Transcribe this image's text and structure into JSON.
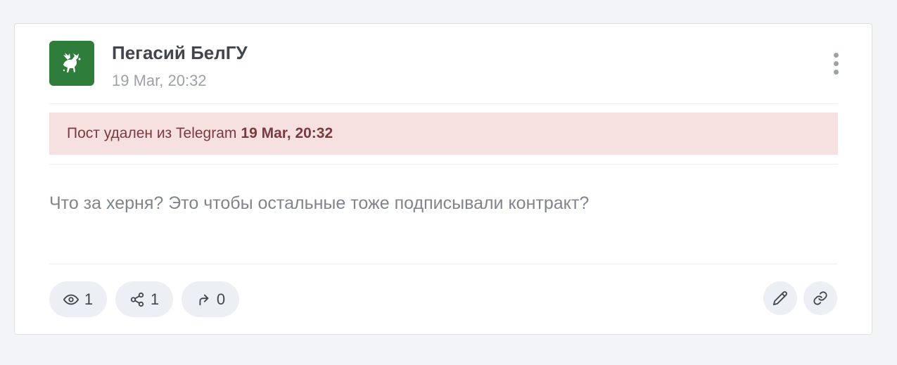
{
  "post": {
    "channel_name": "Пегасий БелГУ",
    "date": "19 Mar, 20:32",
    "avatar_icon": "pegasus-logo",
    "avatar_color": "#2e7d3a"
  },
  "alert": {
    "text": "Пост удален из Telegram",
    "date": "19 Mar, 20:32",
    "background": "#f7e0e0"
  },
  "content": {
    "text": "Что за херня? Это чтобы остальные тоже подписывали контракт?"
  },
  "stats": {
    "views": "1",
    "shares": "1",
    "forwards": "0"
  },
  "actions": {
    "menu_icon": "more-vertical-icon",
    "edit_icon": "pencil-icon",
    "link_icon": "link-icon"
  }
}
